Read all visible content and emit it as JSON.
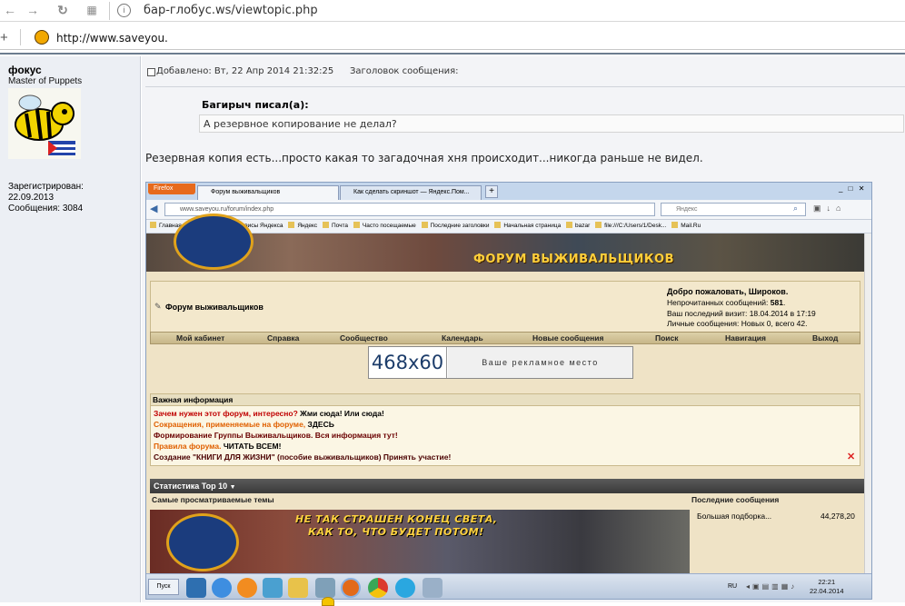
{
  "outer_browser": {
    "address": "бар-глобус.ws/viewtopic.php",
    "bookmark_url": "http://www.saveyou.",
    "nav_icons": [
      "back-arrow-icon",
      "forward-arrow-icon",
      "reload-icon",
      "apps-grid-icon",
      "page-info-icon"
    ]
  },
  "post": {
    "author": "фокус",
    "rank": "Master of Puppets",
    "registered_label": "Зарегистрирован:",
    "registered_date": "22.09.2013",
    "messages": "Сообщения: 3084",
    "added": "Добавлено: Вт, 22 Апр 2014 21:32:25",
    "subject_label": "Заголовок сообщения:",
    "quote_author": "Багирыч писал(а):",
    "quote_text": "А резервное копирование не делал?",
    "body": "Резервная копия есть...просто какая то загадочная хня происходит...никогда раньше не видел."
  },
  "screenshot": {
    "firefox_label": "Firefox",
    "tabs": [
      "Форум выживальщиков",
      "Как сделать скриншот — Яндекс.Пом..."
    ],
    "url": "www.saveyou.ru/forum/index.php",
    "search_placeholder": "Яндекс",
    "bookmarks": [
      "Главная страница Я...",
      "Сервисы Яндекса",
      "Яндекс",
      "Почта",
      "Часто посещаемые",
      "Последние заголовки",
      "Начальная страница",
      "bazar",
      "file:///C:/Users/1/Desk...",
      "Mail.Ru"
    ],
    "forum_banner_title": "ФОРУМ ВЫЖИВАЛЬЩИКОВ",
    "forum_name": "Форум выживальщиков",
    "welcome": "Добро пожаловать, Широков.",
    "unread_label": "Непрочитанных сообщений:",
    "unread_count": "581",
    "last_visit_label": "Ваш последний визит: 18.04.2014 в",
    "last_visit_time": "17:19",
    "personal": "Личные сообщения: Новых 0, всего 42.",
    "menu": [
      "Мой кабинет",
      "Справка",
      "Сообщество",
      "Календарь",
      "Новые сообщения",
      "Поиск",
      "Навигация",
      "Выход"
    ],
    "ad_size": "468x60",
    "ad_text": "Ваше рекламное место",
    "important_title": "Важная информация",
    "important_lines": [
      {
        "a": "Зачем нужен этот форум, интересно?",
        "b": " Жми сюда! Или сюда!"
      },
      {
        "a": "Сокращения, применяемые на форуме,",
        "b": " ЗДЕСЬ"
      },
      {
        "a": "",
        "b": "Формирование Группы Выживальщиков. Вся информация тут!"
      },
      {
        "a": "Правила форума.",
        "b": " ЧИТАТЬ ВСЕМ!"
      },
      {
        "a": "",
        "b": "Создание \"КНИГИ ДЛЯ ЖИЗНИ\" (пособие выживальщиков) Принять участие!"
      }
    ],
    "stats_title": "Статистика Top 10",
    "most_viewed": "Самые просматриваемые темы",
    "latest_posts": "Последние сообщения",
    "latest_item": "Большая подборка...",
    "latest_views": "44,278,20",
    "stat_banner_line1": "НЕ ТАК СТРАШЕН КОНЕЦ СВЕТА,",
    "stat_banner_line2": "КАК ТО, ЧТО БУДЕТ ПОТОМ!",
    "start_label": "Пуск",
    "lang": "RU",
    "clock_time": "22:21",
    "clock_date": "22.04.2014"
  }
}
